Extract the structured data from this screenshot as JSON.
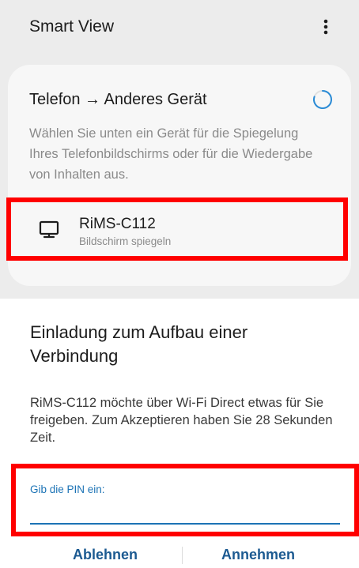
{
  "smart_view": {
    "title": "Smart View",
    "section_title": "Telefon → Anderes Gerät",
    "description": "Wählen Sie unten ein Gerät für die Spiegelung Ihres Telefonbildschirms oder für die Wiedergabe von Inhalten aus.",
    "device": {
      "name": "RiMS-C112",
      "subtitle": "Bildschirm spiegeln",
      "icon": "tv-monitor-icon"
    },
    "menu_icon": "more-vertical-icon",
    "spinner_icon": "loading-spinner-icon"
  },
  "dialog": {
    "title": "Einladung zum Aufbau einer Verbindung",
    "body": "RiMS-C112 möchte über Wi-Fi Direct etwas für Sie freigeben. Zum Akzeptieren haben Sie 28 Sekunden Zeit.",
    "pin_label": "Gib die PIN ein:",
    "pin_value": "",
    "decline_label": "Ablehnen",
    "accept_label": "Annehmen"
  },
  "colors": {
    "highlight": "#ff0000",
    "accent": "#1c73b5",
    "button_text": "#1c5a91"
  }
}
